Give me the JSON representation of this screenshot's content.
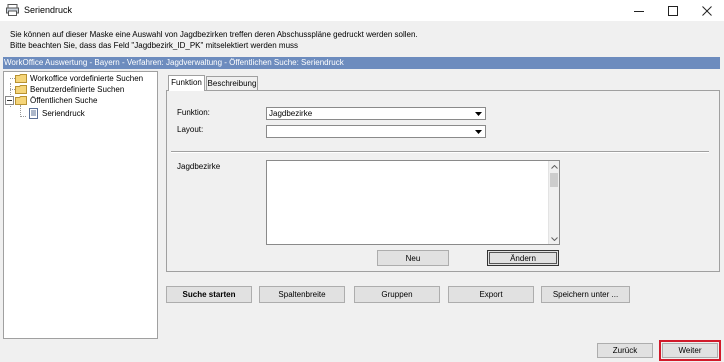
{
  "window": {
    "title": "Seriendruck",
    "controls": [
      "minimize",
      "maximize",
      "close"
    ]
  },
  "info": {
    "line1": "Sie können auf dieser Maske eine Auswahl von Jagdbezirken treffen deren Abschusspläne gedruckt werden sollen.",
    "line2": "Bitte beachten Sie, dass das Feld \"Jagdbezirk_ID_PK\" mitselektiert werden muss"
  },
  "path_bar": "WorkOffice Auswertung - Bayern - Verfahren: Jagdverwaltung - Öffentlichen Suche: Seriendruck",
  "tree": {
    "items": [
      {
        "label": "Workoffice vordefinierte Suchen",
        "icon": "folder-icon"
      },
      {
        "label": "Benutzerdefinierte Suchen",
        "icon": "folder-icon"
      },
      {
        "label": "Öffentlichen Suche",
        "icon": "folder-icon"
      },
      {
        "label": "Seriendruck",
        "icon": "document-icon"
      }
    ]
  },
  "tabs": [
    {
      "label": "Funktion",
      "active": true
    },
    {
      "label": "Beschreibung",
      "active": false
    }
  ],
  "form": {
    "funktion_label": "Funktion:",
    "funktion_value": "Jagdbezirke",
    "layout_label": "Layout:",
    "layout_value": "",
    "list_label": "Jagdbezirke",
    "neu_label": "Neu",
    "aendern_label": "Ändern"
  },
  "toolbar": {
    "suche_starten": "Suche starten",
    "spaltenbreite": "Spaltenbreite",
    "gruppen": "Gruppen",
    "export": "Export",
    "speichern_unter": "Speichern unter ..."
  },
  "footer": {
    "zurueck": "Zurück",
    "weiter": "Weiter"
  },
  "colors": {
    "path_bar": "#6d8cbe",
    "highlight": "#d11a2a",
    "window_bg": "#f0f0f0"
  }
}
